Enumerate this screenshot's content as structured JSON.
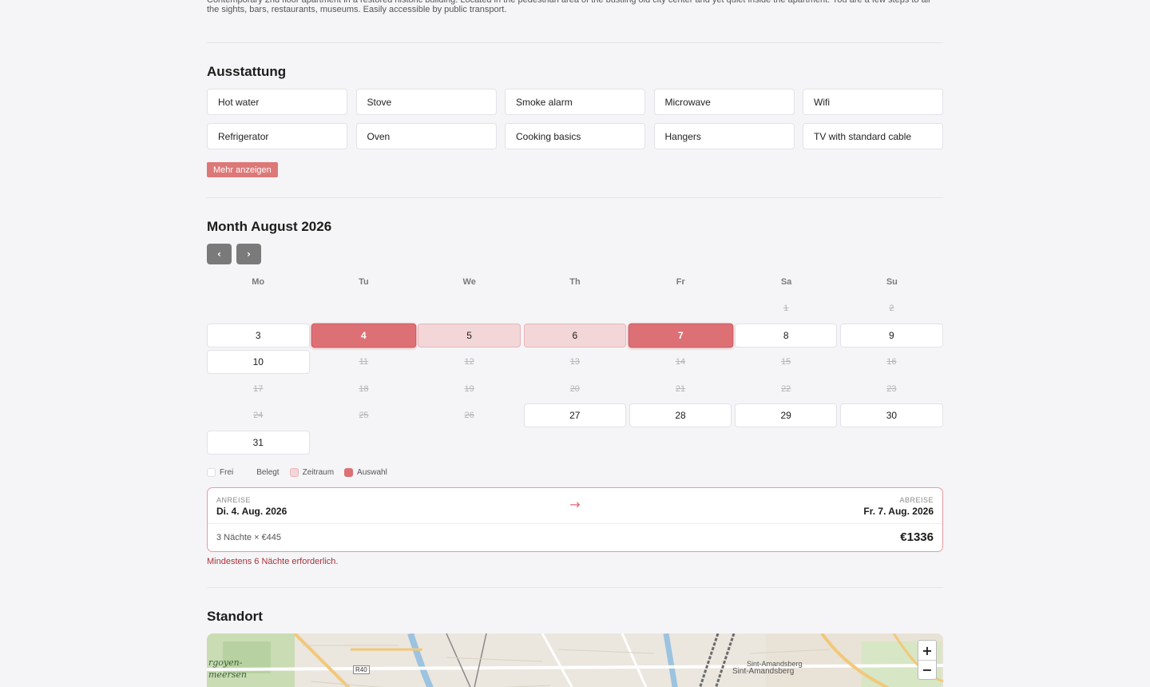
{
  "description": "Contemporary 2nd floor apartment in a restored historic building. Located in the pedestrian area of the bustling old city center and yet quiet inside the apartment. You are a few steps to all the sights, bars, restaurants, museums. Easily accessible by public transport.",
  "amenities": {
    "title": "Ausstattung",
    "items": [
      "Hot water",
      "Stove",
      "Smoke alarm",
      "Microwave",
      "Wifi",
      "Refrigerator",
      "Oven",
      "Cooking basics",
      "Hangers",
      "TV with standard cable"
    ],
    "more_label": "Mehr anzeigen"
  },
  "calendar": {
    "title": "Month August 2026",
    "prev_label": "‹",
    "next_label": "›",
    "weekdays": [
      "Mo",
      "Tu",
      "We",
      "Th",
      "Fr",
      "Sa",
      "Su"
    ],
    "days": [
      {
        "n": "",
        "s": "empty"
      },
      {
        "n": "",
        "s": "empty"
      },
      {
        "n": "",
        "s": "empty"
      },
      {
        "n": "",
        "s": "empty"
      },
      {
        "n": "",
        "s": "empty"
      },
      {
        "n": "1",
        "s": "booked"
      },
      {
        "n": "2",
        "s": "booked"
      },
      {
        "n": "3",
        "s": "free"
      },
      {
        "n": "4",
        "s": "selected"
      },
      {
        "n": "5",
        "s": "range"
      },
      {
        "n": "6",
        "s": "range"
      },
      {
        "n": "7",
        "s": "selected"
      },
      {
        "n": "8",
        "s": "free"
      },
      {
        "n": "9",
        "s": "free"
      },
      {
        "n": "10",
        "s": "free"
      },
      {
        "n": "11",
        "s": "booked"
      },
      {
        "n": "12",
        "s": "booked"
      },
      {
        "n": "13",
        "s": "booked"
      },
      {
        "n": "14",
        "s": "booked"
      },
      {
        "n": "15",
        "s": "booked"
      },
      {
        "n": "16",
        "s": "booked"
      },
      {
        "n": "17",
        "s": "booked"
      },
      {
        "n": "18",
        "s": "booked"
      },
      {
        "n": "19",
        "s": "booked"
      },
      {
        "n": "20",
        "s": "booked"
      },
      {
        "n": "21",
        "s": "booked"
      },
      {
        "n": "22",
        "s": "booked"
      },
      {
        "n": "23",
        "s": "booked"
      },
      {
        "n": "24",
        "s": "booked"
      },
      {
        "n": "25",
        "s": "booked"
      },
      {
        "n": "26",
        "s": "booked"
      },
      {
        "n": "27",
        "s": "free"
      },
      {
        "n": "28",
        "s": "free"
      },
      {
        "n": "29",
        "s": "free"
      },
      {
        "n": "30",
        "s": "free"
      },
      {
        "n": "31",
        "s": "free"
      }
    ],
    "legend": {
      "free": "Frei",
      "booked": "Belegt",
      "range": "Zeitraum",
      "selection": "Auswahl"
    }
  },
  "booking": {
    "checkin_label": "ANREISE",
    "checkin_date": "Di. 4. Aug. 2026",
    "checkout_label": "ABREISE",
    "checkout_date": "Fr. 7. Aug. 2026",
    "arrow": "→",
    "nights_text": "3 Nächte × €445",
    "total": "€1336",
    "warning": "Mindestens 6 Nächte erforderlich."
  },
  "location": {
    "title": "Standort",
    "zoom_in": "+",
    "zoom_out": "−",
    "labels": [
      "rgoyen-",
      "meersen",
      "Sint-Amandsberg",
      "Sint-Amandsberg",
      "R40"
    ]
  },
  "colors": {
    "accent": "#dd7075",
    "range": "#f3d6d8",
    "warning": "#a8323a"
  }
}
